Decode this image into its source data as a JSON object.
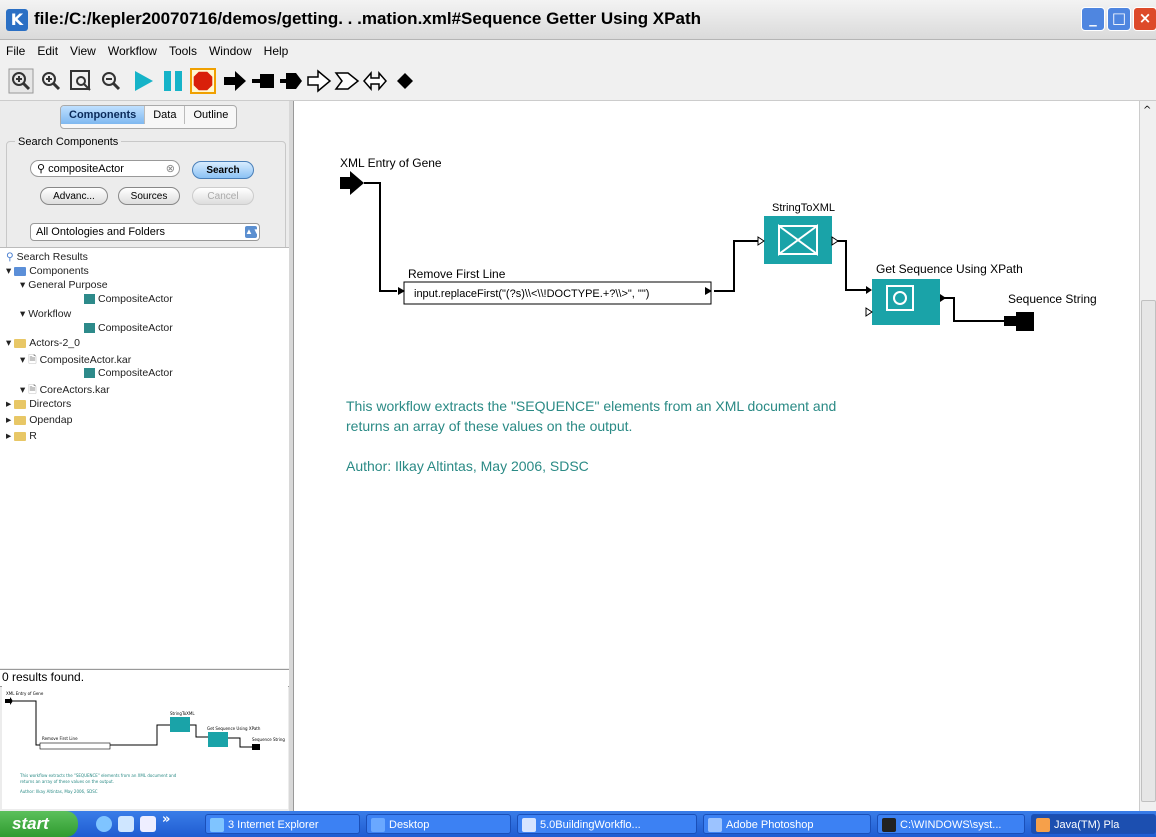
{
  "window": {
    "title": "file:/C:/kepler20070716/demos/getting. . .mation.xml#Sequence Getter Using XPath",
    "app_icon": "K"
  },
  "menu": [
    "File",
    "Edit",
    "View",
    "Workflow",
    "Tools",
    "Window",
    "Help"
  ],
  "toolbar_icons": [
    "zoom-in-icon",
    "zoom-reset-icon",
    "zoom-fit-icon",
    "zoom-out-icon",
    "run-icon",
    "pause-icon",
    "stop-icon",
    "arrow-icon",
    "flag-icon",
    "fat-arrow-icon",
    "hollow-arrow-icon",
    "hollow-chevron-icon",
    "hollow-double-arrow-icon",
    "diamond-icon"
  ],
  "left_panel": {
    "tabs": [
      "Components",
      "Data",
      "Outline"
    ],
    "search_group_label": "Search Components",
    "search_value": "compositeActor",
    "search_button": "Search",
    "advanced_button": "Advanc...",
    "sources_button": "Sources",
    "cancel_button": "Cancel",
    "ontology_select": "All Ontologies and Folders",
    "tree": [
      "Search Results",
      "Components",
      "General Purpose",
      "CompositeActor",
      "Workflow",
      "CompositeActor",
      "Actors-2_0",
      "CompositeActor.kar",
      "CompositeActor",
      "CoreActors.kar",
      "Directors",
      "Opendap",
      "R"
    ],
    "status": "0 results found."
  },
  "workflow": {
    "port_label": "XML Entry of Gene",
    "remove_label": "Remove First Line",
    "expression": "input.replaceFirst(\"(?s)\\\\<\\\\!DOCTYPE.+?\\\\>\", \"\")",
    "string_to_xml": "StringToXML",
    "get_sequence": "Get Sequence Using XPath",
    "output_label": "Sequence String",
    "note_line1": "This workflow extracts the \"SEQUENCE\" elements from an XML document and",
    "note_line2": "returns an array of these values on the output.",
    "author": "Author: Ilkay Altintas, May 2006, SDSC",
    "teal_color": "#1aa3a8",
    "note_color": "#2a8a85"
  },
  "taskbar": {
    "start": "start",
    "tasks": [
      "3 Internet Explorer",
      "Desktop",
      "5.0BuildingWorkflo...",
      "Adobe Photoshop",
      "C:\\WINDOWS\\syst...",
      "Java(TM) Pla"
    ]
  }
}
